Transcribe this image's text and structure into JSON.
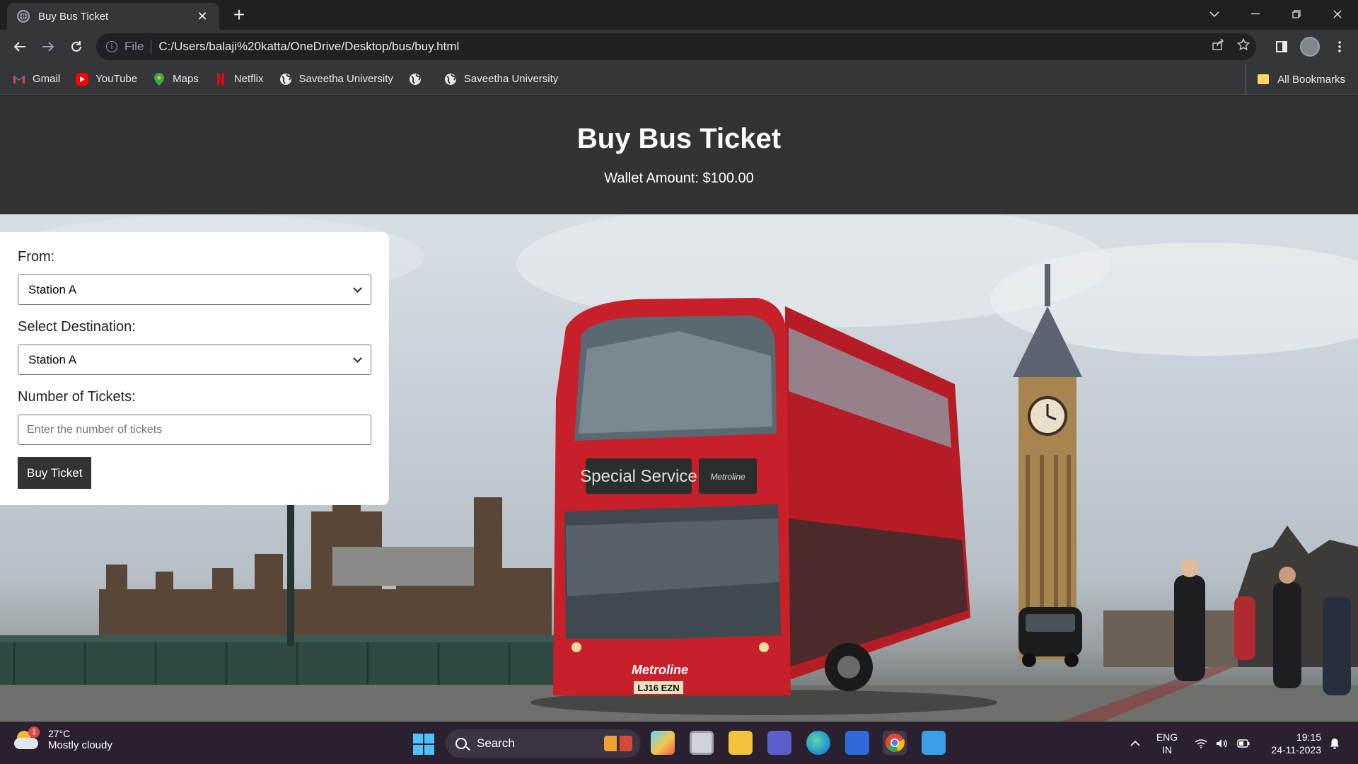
{
  "browser": {
    "tab_title": "Buy Bus Ticket",
    "tab_close": "✕",
    "new_tab": "+",
    "omnibox_prefix": "File",
    "url": "C:/Users/balaji%20katta/OneDrive/Desktop/bus/buy.html",
    "bookmarks": [
      {
        "label": "Gmail",
        "icon": "gmail-icon",
        "color": "#ea4335"
      },
      {
        "label": "YouTube",
        "icon": "youtube-icon",
        "color": "#ff0000"
      },
      {
        "label": "Maps",
        "icon": "maps-icon",
        "color": "#34a853"
      },
      {
        "label": "Netflix",
        "icon": "netflix-icon",
        "color": "#e50914"
      },
      {
        "label": "Saveetha University",
        "icon": "globe-icon",
        "color": "#e8eaed"
      },
      {
        "label": "",
        "icon": "globe-icon",
        "color": "#e8eaed"
      },
      {
        "label": "Saveetha University",
        "icon": "globe-icon",
        "color": "#e8eaed"
      }
    ],
    "all_bookmarks": "All Bookmarks"
  },
  "page": {
    "title": "Buy Bus Ticket",
    "wallet": "Wallet Amount: $100.00",
    "form": {
      "from_label": "From:",
      "from_value": "Station A",
      "destination_label": "Select Destination:",
      "destination_value": "Station A",
      "tickets_label": "Number of Tickets:",
      "tickets_placeholder": "Enter the number of tickets",
      "buy_label": "Buy Ticket"
    }
  },
  "taskbar": {
    "weather_temp": "27°C",
    "weather_desc": "Mostly cloudy",
    "weather_badge": "1",
    "search_label": "Search",
    "lang_line1": "ENG",
    "lang_line2": "IN",
    "time": "19:15",
    "date": "24-11-2023"
  },
  "colors": {
    "header_bg": "#333333",
    "button_bg": "#333333",
    "bus_red": "#c8202a"
  }
}
